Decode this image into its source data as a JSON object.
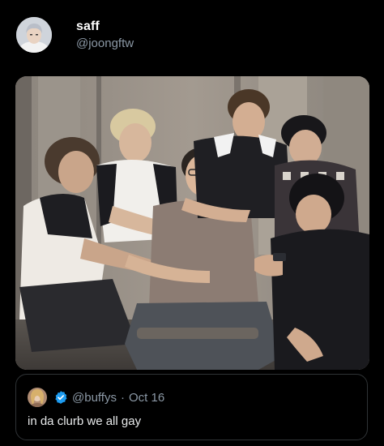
{
  "tweet": {
    "author": {
      "display_name": "saff",
      "handle": "@joongftw",
      "avatar_icon": "avatar"
    },
    "media": {
      "type": "photo",
      "description_icon": "group-photo"
    },
    "quoted": {
      "handle": "@buffys",
      "separator": "·",
      "date": "Oct 16",
      "verified_icon": "verified-badge-icon",
      "text": "in da clurb we all gay"
    }
  },
  "colors": {
    "background": "#000000",
    "primary_text": "#e7e9ea",
    "secondary_text": "#8b98a5",
    "border": "#2f3336",
    "verified": "#1d9bf0"
  }
}
